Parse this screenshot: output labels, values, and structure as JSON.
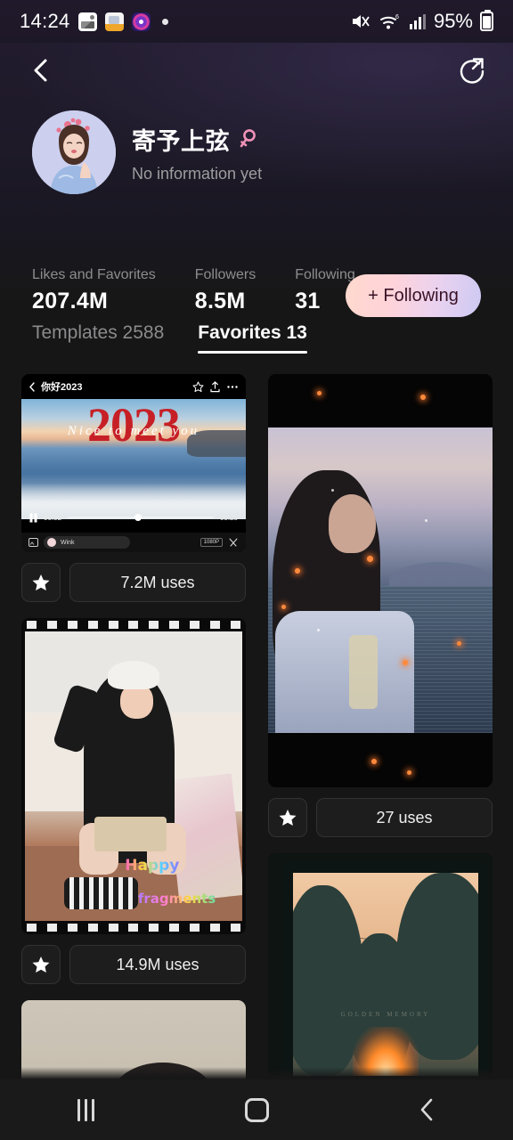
{
  "status_bar": {
    "time": "14:24",
    "battery_percent": "95%",
    "icons": [
      "photos-icon",
      "note-icon",
      "camera-icon",
      "dot-indicator",
      "mute-icon",
      "wifi-icon",
      "signal-icon",
      "battery-icon"
    ]
  },
  "header": {
    "back_icon": "back-chevron-icon",
    "share_icon": "share-circle-icon",
    "profile": {
      "name": "寄予上弦",
      "gender_icon": "female-gender-icon",
      "bio": "No information yet",
      "avatar_alt": "avatar"
    }
  },
  "stats": [
    {
      "label": "Likes and Favorites",
      "value": "207.4M"
    },
    {
      "label": "Followers",
      "value": "8.5M"
    },
    {
      "label": "Following",
      "value": "31"
    }
  ],
  "follow_button": {
    "label": "+ Following",
    "gradient_start": "#ffd9cd",
    "gradient_end": "#cdc9f3",
    "text_color": "#3a1226"
  },
  "tabs": [
    {
      "label": "Templates 2588",
      "active": false
    },
    {
      "label": "Favorites 13",
      "active": true
    }
  ],
  "feed": {
    "left_column": [
      {
        "type": "video-player-template",
        "uses": "7.2M uses",
        "favorite_icon": "star-filled-icon",
        "player": {
          "title": "你好2023",
          "back_icon": "back-chevron-icon",
          "star_icon": "star-outline-icon",
          "upload_icon": "upload-icon",
          "more_icon": "more-dots-icon",
          "overlay_year": "2023",
          "overlay_script": "Nice to meet you",
          "current_time": "00:52",
          "total_time": "03:28",
          "pause_icon": "pause-icon",
          "watermark": "Wink",
          "quality_badge": "1080P",
          "gallery_icon": "gallery-icon",
          "cut_icon": "cut-icon"
        }
      },
      {
        "type": "filmstrip-photo-template",
        "uses": "14.9M uses",
        "favorite_icon": "star-filled-icon",
        "overlay_line1": "Happy",
        "overlay_line2": "fragments"
      },
      {
        "type": "portrait-peek-template",
        "uses": "",
        "favorite_icon": "star-filled-icon"
      }
    ],
    "right_column": [
      {
        "type": "seaside-portrait-template",
        "uses": "27 uses",
        "favorite_icon": "star-filled-icon"
      },
      {
        "type": "sunset-trees-template",
        "uses": "",
        "favorite_icon": "star-filled-icon",
        "overlay_text": "GOLDEN MEMORY"
      }
    ]
  },
  "navigation_bar": {
    "recents_label": "recents",
    "home_label": "home",
    "back_label": "back"
  }
}
